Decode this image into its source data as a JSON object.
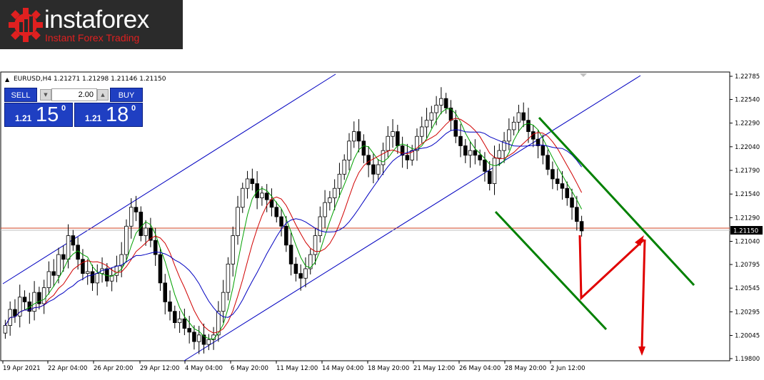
{
  "logo": {
    "name": "instaforex",
    "tagline": "Instant Forex Trading"
  },
  "chart_data": {
    "type": "candlestick",
    "title": "EURUSD,H4  1.21271 1.21298 1.21146 1.21150",
    "symbol": "EURUSD",
    "timeframe": "H4",
    "ohlc_last": {
      "open": 1.21271,
      "high": 1.21298,
      "low": 1.21146,
      "close": 1.2115
    },
    "current_price": "1.21150",
    "ylim": [
      1.198,
      1.22785
    ],
    "y_ticks": [
      "1.22785",
      "1.22540",
      "1.22290",
      "1.22040",
      "1.21790",
      "1.21540",
      "1.21290",
      "1.21040",
      "1.20795",
      "1.20545",
      "1.20295",
      "1.20045",
      "1.19800"
    ],
    "x_ticks": [
      "19 Apr 2021",
      "22 Apr 04:00",
      "26 Apr 20:00",
      "29 Apr 12:00",
      "4 May 04:00",
      "6 May 20:00",
      "11 May 12:00",
      "14 May 04:00",
      "18 May 20:00",
      "21 May 12:00",
      "26 May 04:00",
      "28 May 20:00",
      "2 Jun 12:00"
    ],
    "grid": false,
    "series": [
      {
        "name": "",
        "kind": "close",
        "color": "#000000",
        "values": [
          1.2015,
          1.2032,
          1.2025,
          1.2045,
          1.204,
          1.203,
          1.205,
          1.2038,
          1.2055,
          1.2072,
          1.2068,
          1.209,
          1.2085,
          1.211,
          1.21,
          1.2085,
          1.207,
          1.2072,
          1.206,
          1.207,
          1.2075,
          1.2062,
          1.2068,
          1.2078,
          1.209,
          1.212,
          1.214,
          1.2135,
          1.211,
          1.2118,
          1.2105,
          1.209,
          1.206,
          1.204,
          1.203,
          1.2018,
          1.2022,
          1.2012,
          1.2008,
          1.1998,
          1.2005,
          1.1995,
          1.2,
          1.2005,
          1.203,
          1.205,
          1.208,
          1.211,
          1.214,
          1.216,
          1.217,
          1.2165,
          1.215,
          1.2155,
          1.2148,
          1.214,
          1.213,
          1.212,
          1.21,
          1.208,
          1.207,
          1.2065,
          1.2075,
          1.209,
          1.211,
          1.213,
          1.2145,
          1.215,
          1.216,
          1.2175,
          1.219,
          1.221,
          1.222,
          1.221,
          1.2195,
          1.2185,
          1.2175,
          1.2185,
          1.22,
          1.2215,
          1.222,
          1.2205,
          1.2195,
          1.219,
          1.22,
          1.2215,
          1.2225,
          1.2232,
          1.224,
          1.2248,
          1.2255,
          1.2245,
          1.2232,
          1.2215,
          1.2205,
          1.2195,
          1.22,
          1.2195,
          1.219,
          1.2178,
          1.2165,
          1.2192,
          1.22,
          1.221,
          1.2222,
          1.223,
          1.224,
          1.2232,
          1.222,
          1.2212,
          1.2205,
          1.2195,
          1.218,
          1.217,
          1.2165,
          1.216,
          1.215,
          1.214,
          1.2125,
          1.2115
        ]
      },
      {
        "name": "",
        "kind": "ma",
        "color": "#00a000"
      },
      {
        "name": "",
        "kind": "ma",
        "color": "#d00000"
      },
      {
        "name": "",
        "kind": "ma",
        "color": "#0000c0"
      }
    ],
    "annotations": [
      "upward channel (blue)",
      "downward channel (green)",
      "forecast arrows (red)"
    ]
  },
  "trade_panel": {
    "sell_label": "SELL",
    "buy_label": "BUY",
    "lot_value": "2.00",
    "sell_price": {
      "prefix": "1.21",
      "big": "15",
      "sup": "0"
    },
    "buy_price": {
      "prefix": "1.21",
      "big": "18",
      "sup": "0"
    }
  },
  "colors": {
    "bull": "#ffffff",
    "bear": "#000000",
    "ma_fast": "#00a000",
    "ma_mid": "#d00000",
    "ma_slow": "#0000c0",
    "channel_up": "#0000c0",
    "channel_down": "#008000",
    "forecast": "#e00000",
    "price_line": "#d04020",
    "axis_label_bg": "#000000"
  }
}
